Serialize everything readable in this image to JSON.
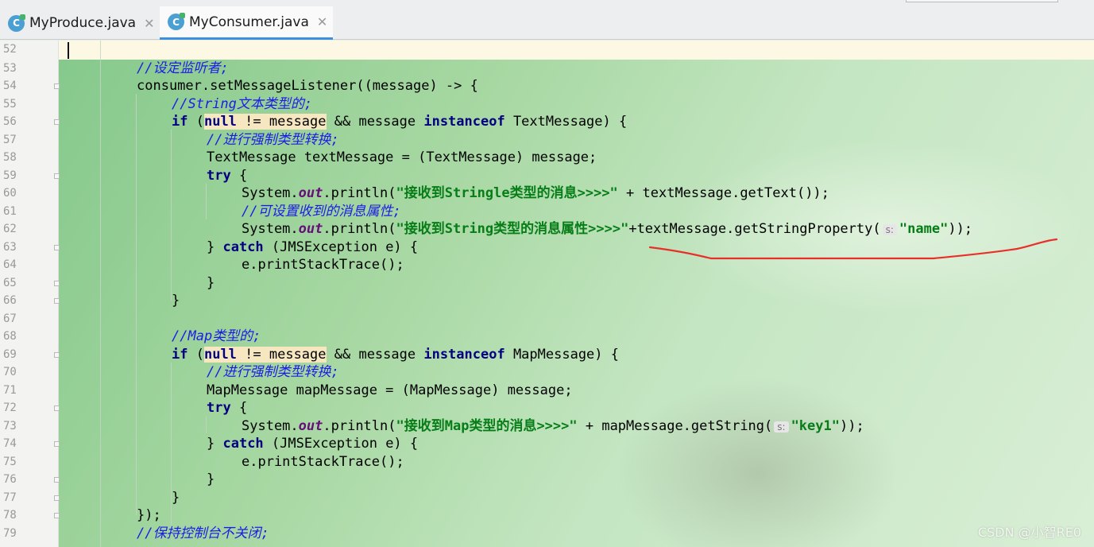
{
  "tabs": [
    {
      "icon": "C",
      "label": "MyProduce.java",
      "active": false
    },
    {
      "icon": "C",
      "label": "MyConsumer.java",
      "active": true
    }
  ],
  "close_glyph": "✕",
  "editor": {
    "current_line": 52,
    "lines": [
      {
        "n": 52,
        "fold": false,
        "indent": 0,
        "tokens": []
      },
      {
        "n": 53,
        "fold": false,
        "indent": 2,
        "tokens": [
          {
            "t": "//设定监听者;",
            "c": "cm"
          }
        ]
      },
      {
        "n": 54,
        "fold": true,
        "indent": 2,
        "tokens": [
          {
            "t": "consumer.setMessageListener((message) -> {",
            "c": ""
          }
        ]
      },
      {
        "n": 55,
        "fold": false,
        "indent": 3,
        "tokens": [
          {
            "t": "//String文本类型的;",
            "c": "cm"
          }
        ]
      },
      {
        "n": 56,
        "fold": true,
        "indent": 3,
        "tokens": [
          {
            "t": "if",
            "c": "kw"
          },
          {
            "t": " (",
            "c": ""
          },
          {
            "t": "null != message",
            "c": "hlx"
          },
          {
            "t": " && message ",
            "c": ""
          },
          {
            "t": "instanceof",
            "c": "kw"
          },
          {
            "t": " TextMessage) {",
            "c": ""
          }
        ]
      },
      {
        "n": 57,
        "fold": false,
        "indent": 4,
        "tokens": [
          {
            "t": "//进行强制类型转换;",
            "c": "cm"
          }
        ]
      },
      {
        "n": 58,
        "fold": false,
        "indent": 4,
        "tokens": [
          {
            "t": "TextMessage textMessage = (TextMessage) message;",
            "c": ""
          }
        ]
      },
      {
        "n": 59,
        "fold": true,
        "indent": 4,
        "tokens": [
          {
            "t": "try",
            "c": "kw"
          },
          {
            "t": " {",
            "c": ""
          }
        ]
      },
      {
        "n": 60,
        "fold": false,
        "indent": 5,
        "tokens": [
          {
            "t": "System.",
            "c": ""
          },
          {
            "t": "out",
            "c": "fd"
          },
          {
            "t": ".println(",
            "c": ""
          },
          {
            "t": "\"接收到Stringle类型的消息>>>>\"",
            "c": "st"
          },
          {
            "t": " + textMessage.getText());",
            "c": ""
          }
        ]
      },
      {
        "n": 61,
        "fold": false,
        "indent": 5,
        "tokens": [
          {
            "t": "//可设置收到的消息属性;",
            "c": "cm"
          }
        ]
      },
      {
        "n": 62,
        "fold": false,
        "indent": 5,
        "tokens": [
          {
            "t": "System.",
            "c": ""
          },
          {
            "t": "out",
            "c": "fd"
          },
          {
            "t": ".println(",
            "c": ""
          },
          {
            "t": "\"接收到String类型的消息属性>>>>\"",
            "c": "st"
          },
          {
            "t": "+textMessage.getStringProperty(",
            "c": ""
          },
          {
            "t": "s:",
            "c": "hint"
          },
          {
            "t": "\"name\"",
            "c": "st"
          },
          {
            "t": "));",
            "c": ""
          }
        ]
      },
      {
        "n": 63,
        "fold": true,
        "indent": 4,
        "tokens": [
          {
            "t": "} ",
            "c": ""
          },
          {
            "t": "catch",
            "c": "kw"
          },
          {
            "t": " (JMSException e) {",
            "c": ""
          }
        ]
      },
      {
        "n": 64,
        "fold": false,
        "indent": 5,
        "tokens": [
          {
            "t": "e.printStackTrace();",
            "c": ""
          }
        ]
      },
      {
        "n": 65,
        "fold": true,
        "indent": 4,
        "tokens": [
          {
            "t": "}",
            "c": ""
          }
        ]
      },
      {
        "n": 66,
        "fold": true,
        "indent": 3,
        "tokens": [
          {
            "t": "}",
            "c": ""
          }
        ]
      },
      {
        "n": 67,
        "fold": false,
        "indent": 0,
        "tokens": []
      },
      {
        "n": 68,
        "fold": false,
        "indent": 3,
        "tokens": [
          {
            "t": "//Map类型的;",
            "c": "cm"
          }
        ]
      },
      {
        "n": 69,
        "fold": true,
        "indent": 3,
        "tokens": [
          {
            "t": "if",
            "c": "kw"
          },
          {
            "t": " (",
            "c": ""
          },
          {
            "t": "null != message",
            "c": "hlx"
          },
          {
            "t": " && message ",
            "c": ""
          },
          {
            "t": "instanceof",
            "c": "kw"
          },
          {
            "t": " MapMessage) {",
            "c": ""
          }
        ]
      },
      {
        "n": 70,
        "fold": false,
        "indent": 4,
        "tokens": [
          {
            "t": "//进行强制类型转换;",
            "c": "cm"
          }
        ]
      },
      {
        "n": 71,
        "fold": false,
        "indent": 4,
        "tokens": [
          {
            "t": "MapMessage mapMessage = (MapMessage) message;",
            "c": ""
          }
        ]
      },
      {
        "n": 72,
        "fold": true,
        "indent": 4,
        "tokens": [
          {
            "t": "try",
            "c": "kw"
          },
          {
            "t": " {",
            "c": ""
          }
        ]
      },
      {
        "n": 73,
        "fold": false,
        "indent": 5,
        "tokens": [
          {
            "t": "System.",
            "c": ""
          },
          {
            "t": "out",
            "c": "fd"
          },
          {
            "t": ".println(",
            "c": ""
          },
          {
            "t": "\"接收到Map类型的消息>>>>\"",
            "c": "st"
          },
          {
            "t": " + mapMessage.getString(",
            "c": ""
          },
          {
            "t": "s:",
            "c": "hint"
          },
          {
            "t": "\"key1\"",
            "c": "st"
          },
          {
            "t": "));",
            "c": ""
          }
        ]
      },
      {
        "n": 74,
        "fold": true,
        "indent": 4,
        "tokens": [
          {
            "t": "} ",
            "c": ""
          },
          {
            "t": "catch",
            "c": "kw"
          },
          {
            "t": " (JMSException e) {",
            "c": ""
          }
        ]
      },
      {
        "n": 75,
        "fold": false,
        "indent": 5,
        "tokens": [
          {
            "t": "e.printStackTrace();",
            "c": ""
          }
        ]
      },
      {
        "n": 76,
        "fold": true,
        "indent": 4,
        "tokens": [
          {
            "t": "}",
            "c": ""
          }
        ]
      },
      {
        "n": 77,
        "fold": true,
        "indent": 3,
        "tokens": [
          {
            "t": "}",
            "c": ""
          }
        ]
      },
      {
        "n": 78,
        "fold": true,
        "indent": 2,
        "tokens": [
          {
            "t": "});",
            "c": ""
          }
        ]
      },
      {
        "n": 79,
        "fold": false,
        "indent": 2,
        "tokens": [
          {
            "t": "//保持控制台不关闭;",
            "c": "cm"
          }
        ]
      }
    ]
  },
  "annotation_color": "#e8302a",
  "watermark": "CSDN @小智RE0"
}
